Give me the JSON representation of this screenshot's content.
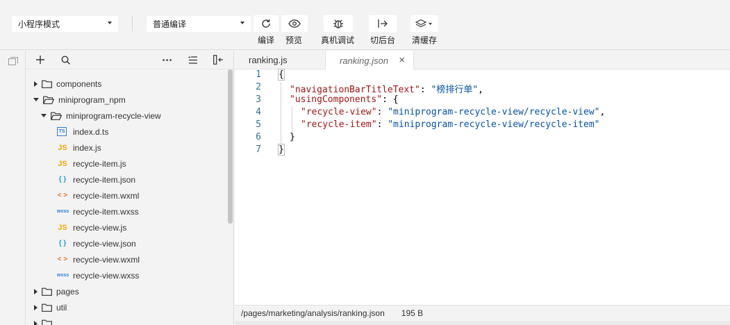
{
  "toolbar": {
    "mode_select": "小程序模式",
    "compile_select": "普通编译",
    "buttons": [
      {
        "label": "编译",
        "icon": "refresh-icon"
      },
      {
        "label": "预览",
        "icon": "eye-icon"
      },
      {
        "label": "真机调试",
        "icon": "bug-icon"
      },
      {
        "label": "切后台",
        "icon": "switch-background-icon"
      },
      {
        "label": "清缓存",
        "icon": "layers-icon"
      }
    ]
  },
  "explorer": {
    "actions": [
      "plus-icon",
      "search-icon",
      "more-icon",
      "collapse-icon",
      "split-icon"
    ],
    "tree": [
      {
        "label": "components",
        "type": "folder",
        "expanded": false,
        "depth": 0
      },
      {
        "label": "miniprogram_npm",
        "type": "folder",
        "expanded": true,
        "depth": 0
      },
      {
        "label": "miniprogram-recycle-view",
        "type": "folder",
        "expanded": true,
        "depth": 1
      },
      {
        "label": "index.d.ts",
        "type": "ts",
        "depth": 2
      },
      {
        "label": "index.js",
        "type": "js",
        "depth": 2
      },
      {
        "label": "recycle-item.js",
        "type": "js",
        "depth": 2
      },
      {
        "label": "recycle-item.json",
        "type": "json",
        "depth": 2
      },
      {
        "label": "recycle-item.wxml",
        "type": "wxml",
        "depth": 2
      },
      {
        "label": "recycle-item.wxss",
        "type": "wxss",
        "depth": 2
      },
      {
        "label": "recycle-view.js",
        "type": "js",
        "depth": 2
      },
      {
        "label": "recycle-view.json",
        "type": "json",
        "depth": 2
      },
      {
        "label": "recycle-view.wxml",
        "type": "wxml",
        "depth": 2
      },
      {
        "label": "recycle-view.wxss",
        "type": "wxss",
        "depth": 2
      },
      {
        "label": "pages",
        "type": "folder",
        "expanded": false,
        "depth": 0
      },
      {
        "label": "util",
        "type": "folder",
        "expanded": false,
        "depth": 0
      }
    ]
  },
  "icon_glyphs": {
    "ts": "TS",
    "js": "JS",
    "json": "{ }",
    "wxml": "< >",
    "wxss": "wxss"
  },
  "colors": {
    "js": "#f0a800",
    "json": "#1e9bd7",
    "wxml": "#e8711c",
    "wxss": "#2a7fd4",
    "ts": "#2a7fd4"
  },
  "editor": {
    "tabs": [
      {
        "label": "ranking.js",
        "active": false
      },
      {
        "label": "ranking.json",
        "active": true,
        "close": "×"
      }
    ],
    "lines": [
      {
        "num": "1",
        "text": "{"
      },
      {
        "num": "2",
        "key": "\"navigationBarTitleText\"",
        "sep": ": ",
        "value": "\"榜排行单\"",
        "tail": ","
      },
      {
        "num": "3",
        "key": "\"usingComponents\"",
        "sep": ": {",
        "value": "",
        "tail": ""
      },
      {
        "num": "4",
        "key": "\"recycle-view\"",
        "sep": ": ",
        "value": "\"miniprogram-recycle-view/recycle-view\"",
        "tail": ","
      },
      {
        "num": "5",
        "key": "\"recycle-item\"",
        "sep": ": ",
        "value": "\"miniprogram-recycle-view/recycle-item\"",
        "tail": ""
      },
      {
        "num": "6",
        "text": "}"
      },
      {
        "num": "7",
        "text": "}"
      }
    ],
    "status_path": "/pages/marketing/analysis/ranking.json",
    "status_size": "195 B"
  }
}
